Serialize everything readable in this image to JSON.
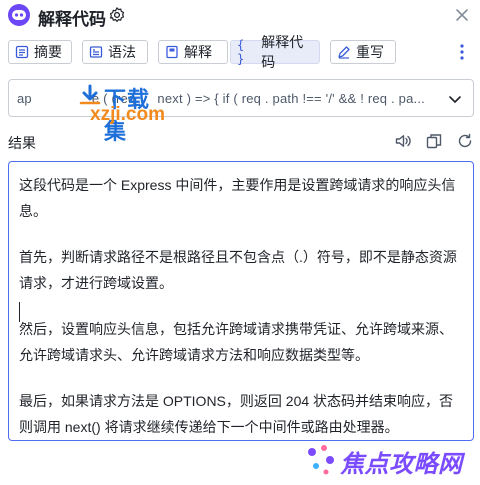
{
  "header": {
    "title": "解释代码",
    "logo_icon": "robot-face-icon",
    "settings_icon": "gear-icon",
    "close_icon": "close-icon"
  },
  "toolbar": {
    "buttons": [
      {
        "label": "摘要",
        "icon": "summary-icon",
        "active": false
      },
      {
        "label": "语法",
        "icon": "grammar-icon",
        "active": false
      },
      {
        "label": "解释",
        "icon": "book-icon",
        "active": false
      },
      {
        "label": "解释代码",
        "icon": "braces-icon",
        "active": true
      },
      {
        "label": "重写",
        "icon": "edit-icon",
        "active": false
      }
    ],
    "more_icon": "more-vertical-icon"
  },
  "code_input": {
    "value": "app.use ( (req, res, next ) => { if ( req . path !== '/' && ! req . pa...",
    "visible_prefix": "ap",
    "visible_suffix": "e ( (req",
    "visible_tail": "next ) => { if ( req . path !== '/' && ! req . pa...",
    "chevron_icon": "chevron-down-icon"
  },
  "watermark": {
    "cn": "下载集",
    "en": "xzji.com"
  },
  "result": {
    "label": "结果",
    "actions": [
      "speaker-icon",
      "copy-icon",
      "refresh-icon"
    ],
    "paragraphs": [
      "这段代码是一个 Express 中间件，主要作用是设置跨域请求的响应头信息。",
      "首先，判断请求路径不是根路径且不包含点（.）符号，即不是静态资源请求，才进行跨域设置。",
      "然后，设置响应头信息，包括允许跨域请求携带凭证、允许跨域来源、允许跨域请求头、允许跨域请求方法和响应数据类型等。",
      "最后，如果请求方法是 OPTIONS，则返回 204 状态码并结束响应，否则调用 next() 将请求继续传递给下一个中间件或路由处理器。"
    ]
  },
  "footer": {
    "brand": "焦点攻略网"
  },
  "colors": {
    "accent": "#4e6ef2",
    "logo": "#6b47f5",
    "active_tab_bg": "#e8ecf8",
    "watermark_blue": "#1e6fd9",
    "watermark_orange": "#f28a1d",
    "footer_brand": "#7b4bff"
  }
}
